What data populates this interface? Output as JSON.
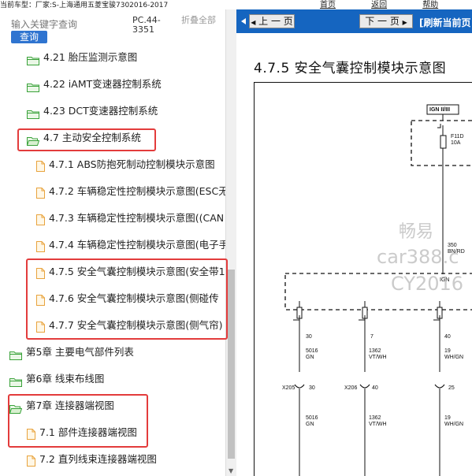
{
  "top": {
    "breadcrumb": "当前车型：厂家:S-上海通用五菱宝骏7302016-2017",
    "tabs": [
      "首页",
      "返回",
      "帮助"
    ]
  },
  "left": {
    "search_placeholder": "输入关键字查询",
    "search_button": "查询",
    "code": "PC.44-3351",
    "collapse": "折叠全部",
    "tree": [
      {
        "label": "4.21 胎压监测示意图",
        "kind": "folder"
      },
      {
        "label": "4.22 iAMT变速器控制系统",
        "kind": "folder"
      },
      {
        "label": "4.23 DCT变速器控制系统",
        "kind": "folder"
      },
      {
        "label": "4.7 主动安全控制系统",
        "kind": "folder-open"
      },
      {
        "label": "4.7.1 ABS防抱死制动控制模块示意图",
        "kind": "file"
      },
      {
        "label": "4.7.2 车辆稳定性控制模块示意图(ESC无",
        "kind": "file"
      },
      {
        "label": "4.7.3 车辆稳定性控制模块示意图((CAN",
        "kind": "file"
      },
      {
        "label": "4.7.4 车辆稳定性控制模块示意图(电子手",
        "kind": "file"
      },
      {
        "label": "4.7.5 安全气囊控制模块示意图(安全带1",
        "kind": "file"
      },
      {
        "label": "4.7.6 安全气囊控制模块示意图(侧碰传",
        "kind": "file"
      },
      {
        "label": "4.7.7 安全气囊控制模块示意图(侧气帘)",
        "kind": "file"
      },
      {
        "label": "第5章 主要电气部件列表",
        "kind": "folder"
      },
      {
        "label": "第6章 线束布线图",
        "kind": "folder"
      },
      {
        "label": "第7章 连接器端视图",
        "kind": "folder-open"
      },
      {
        "label": "7.1 部件连接器端视图",
        "kind": "file"
      },
      {
        "label": "7.2 直列线束连接器端视图",
        "kind": "file"
      }
    ]
  },
  "right": {
    "prev": "上 一 页",
    "next": "下 一 页",
    "refresh": "[刷新当前页",
    "title": "4.7.5 安全气囊控制模块示意图",
    "schematic": {
      "ign_label": "IGN II/III",
      "fuse": "F11D",
      "fuse_amp": "10A",
      "bus_wire": "350",
      "bus_color": "BN/RD",
      "bus_label": "IGN",
      "pins": [
        "30",
        "7",
        "40"
      ],
      "wires": [
        {
          "id": "5016",
          "color": "GN"
        },
        {
          "id": "1362",
          "color": "VT/WH"
        },
        {
          "id": "19",
          "color": "WH/GN"
        }
      ],
      "connectors": [
        {
          "name": "X205",
          "pin": "30"
        },
        {
          "name": "X206",
          "pin": "40"
        },
        {
          "name": "",
          "pin": "25"
        }
      ]
    },
    "watermark": [
      "畅易",
      "car388.c",
      "CY2016"
    ]
  },
  "colors": {
    "nav_bar": "#1565c0",
    "highlight": "#e33c3c",
    "search_button": "#2f74d0",
    "folder_green": "#3aa23a",
    "file_orange": "#e8a33d"
  }
}
